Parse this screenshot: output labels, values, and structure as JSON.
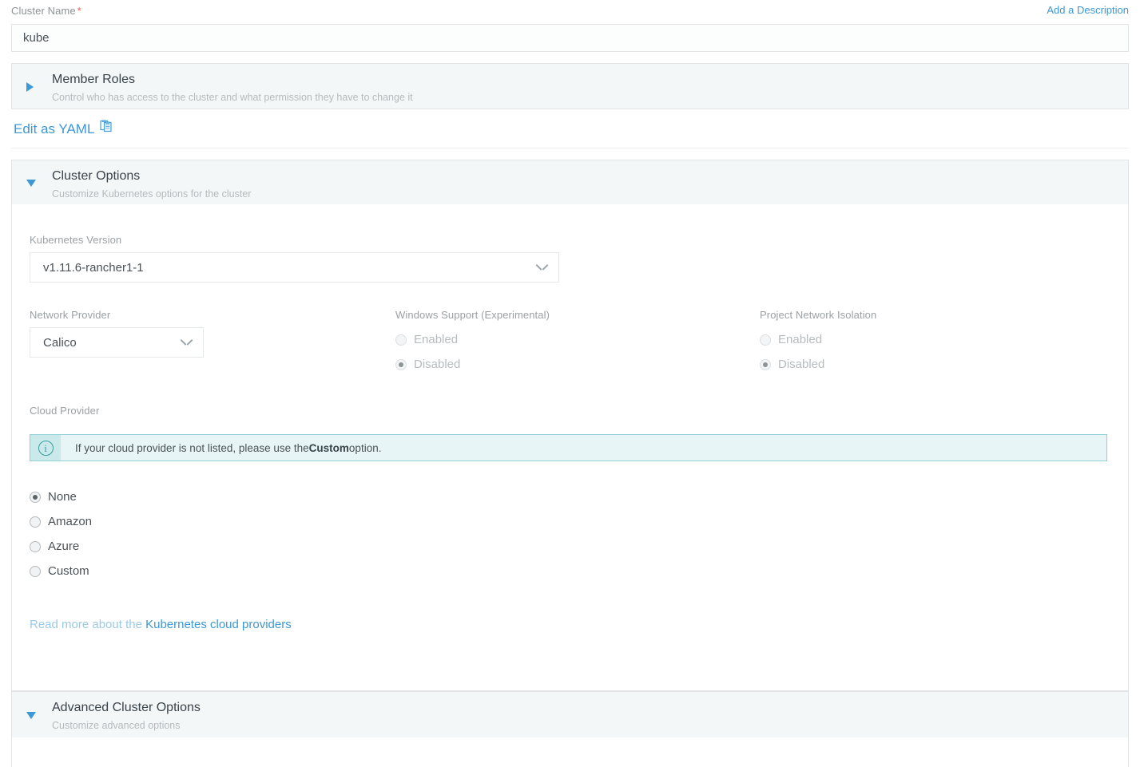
{
  "cluster_name": {
    "label": "Cluster Name",
    "required_marker": "*",
    "value": "kube",
    "add_description_link": "Add a Description"
  },
  "member_roles": {
    "title": "Member Roles",
    "subtitle": "Control who has access to the cluster and what permission they have to change it",
    "expanded": false,
    "toggle_icon": "triangle-right-icon"
  },
  "yaml": {
    "label": "Edit as YAML",
    "icon": "clipboard-copy-icon"
  },
  "cluster_options": {
    "title": "Cluster Options",
    "subtitle": "Customize Kubernetes options for the cluster",
    "expanded": true,
    "toggle_icon": "triangle-down-icon",
    "kubernetes_version": {
      "label": "Kubernetes Version",
      "value": "v1.11.6-rancher1-1",
      "icon": "chevron-down-icon"
    },
    "network_provider": {
      "label": "Network Provider",
      "value": "Calico",
      "icon": "chevron-down-icon"
    },
    "windows_support": {
      "label": "Windows Support (Experimental)",
      "disabled": true,
      "options": [
        {
          "label": "Enabled",
          "selected": false
        },
        {
          "label": "Disabled",
          "selected": true
        }
      ]
    },
    "project_network_isolation": {
      "label": "Project Network Isolation",
      "disabled": true,
      "options": [
        {
          "label": "Enabled",
          "selected": false
        },
        {
          "label": "Disabled",
          "selected": true
        }
      ]
    },
    "cloud_provider": {
      "label": "Cloud Provider",
      "banner": {
        "icon": "info-icon",
        "text_before": "If your cloud provider is not listed, please use the ",
        "text_bold": "Custom",
        "text_after": " option."
      },
      "options": [
        {
          "label": "None",
          "selected": true
        },
        {
          "label": "Amazon",
          "selected": false
        },
        {
          "label": "Azure",
          "selected": false
        },
        {
          "label": "Custom",
          "selected": false
        }
      ],
      "read_more_prefix": "Read more about the ",
      "read_more_link": "Kubernetes cloud providers"
    }
  },
  "advanced_options": {
    "title": "Advanced Cluster Options",
    "subtitle": "Customize advanced options",
    "expanded": true,
    "toggle_icon": "triangle-down-icon"
  },
  "colors": {
    "accent_blue": "#3d98d3",
    "panel_bg": "#f4f7f8",
    "border": "#e2e4e5",
    "banner_bg": "#e7f5f6",
    "banner_border": "#8fd0d6",
    "required_red": "#e8604c"
  }
}
